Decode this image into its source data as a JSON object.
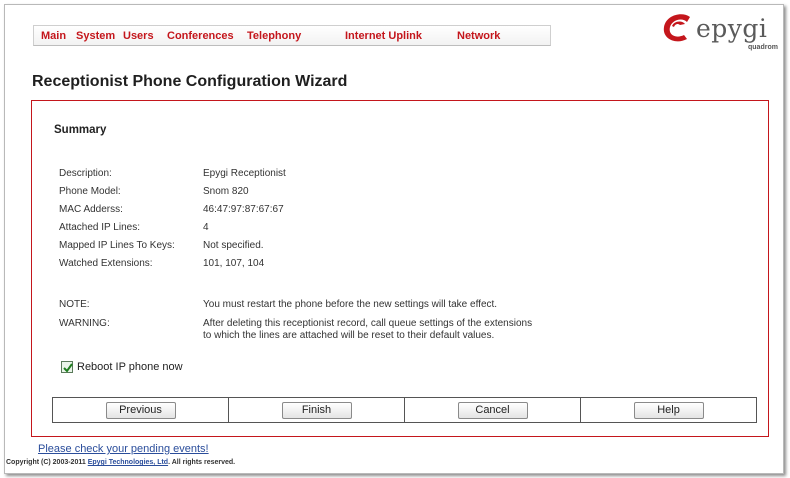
{
  "nav": {
    "items": [
      {
        "label": "Main"
      },
      {
        "label": "System"
      },
      {
        "label": "Users"
      },
      {
        "label": "Conferences"
      },
      {
        "label": "Telephony"
      },
      {
        "label": "Internet Uplink"
      },
      {
        "label": "Network"
      }
    ]
  },
  "logo": {
    "word": "epygi",
    "sub": "quadrom"
  },
  "page": {
    "title": "Receptionist Phone Configuration Wizard"
  },
  "summary": {
    "title": "Summary",
    "rows": [
      {
        "label": "Description:",
        "value": "Epygi Receptionist"
      },
      {
        "label": "Phone Model:",
        "value": "Snom 820"
      },
      {
        "label": "MAC Adderss:",
        "value": "46:47:97:87:67:67"
      },
      {
        "label": "Attached IP Lines:",
        "value": "4"
      },
      {
        "label": "Mapped IP Lines To Keys:",
        "value": "Not specified."
      },
      {
        "label": "Watched Extensions:",
        "value": "101, 107, 104"
      }
    ],
    "note": {
      "label": "NOTE:",
      "value": "You must restart the phone before the new settings will take effect."
    },
    "warning": {
      "label": "WARNING:",
      "line1": "After deleting this receptionist record, call queue settings of the extensions",
      "line2": "to which the lines are attached will be reset to their default values."
    }
  },
  "reboot": {
    "label": "Reboot IP phone now",
    "checked": true
  },
  "buttons": {
    "previous": "Previous",
    "finish": "Finish",
    "cancel": "Cancel",
    "help": "Help"
  },
  "footer": {
    "pending": "Please check your pending events!",
    "copyright_prefix": "Copyright (C) 2003-2011",
    "copyright_company": "Epygi Technologies, Ltd",
    "copyright_suffix": ". All rights reserved."
  },
  "colors": {
    "accent": "#c4161c",
    "link": "#2a4d9b"
  }
}
